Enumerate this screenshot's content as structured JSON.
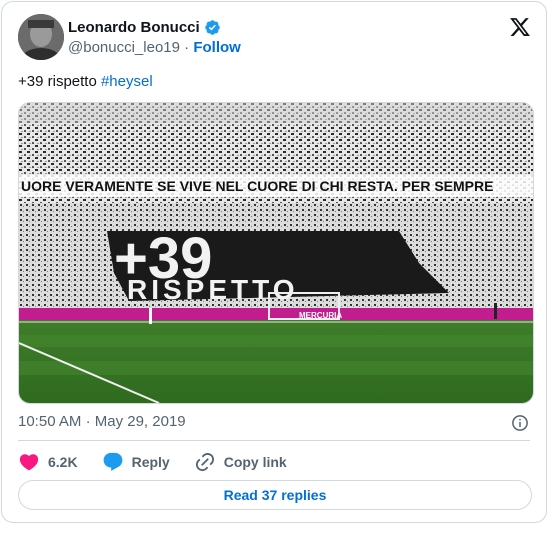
{
  "author": {
    "name": "Leonardo Bonucci",
    "handle": "@bonucci_leo19",
    "separator": "·",
    "follow_label": "Follow"
  },
  "tweet": {
    "text": "+39 rispetto ",
    "hashtag": "#heysel"
  },
  "media": {
    "banner_text": "UORE VERAMENTE SE VIVE NEL CUORE DI CHI RESTA. PER SEMPRE",
    "flag_number": "+39",
    "flag_word": "RISPETTO",
    "ad_text": "MERCURIA"
  },
  "meta": {
    "time": "10:50 AM",
    "separator": "·",
    "date": "May 29, 2019"
  },
  "actions": {
    "likes": "6.2K",
    "reply_label": "Reply",
    "copy_label": "Copy link"
  },
  "read_replies_label": "Read 37 replies",
  "colors": {
    "accent": "#006fd6",
    "like": "#f91880",
    "reply": "#1d9bf0",
    "muted": "#536471",
    "border": "#cfd9de"
  }
}
